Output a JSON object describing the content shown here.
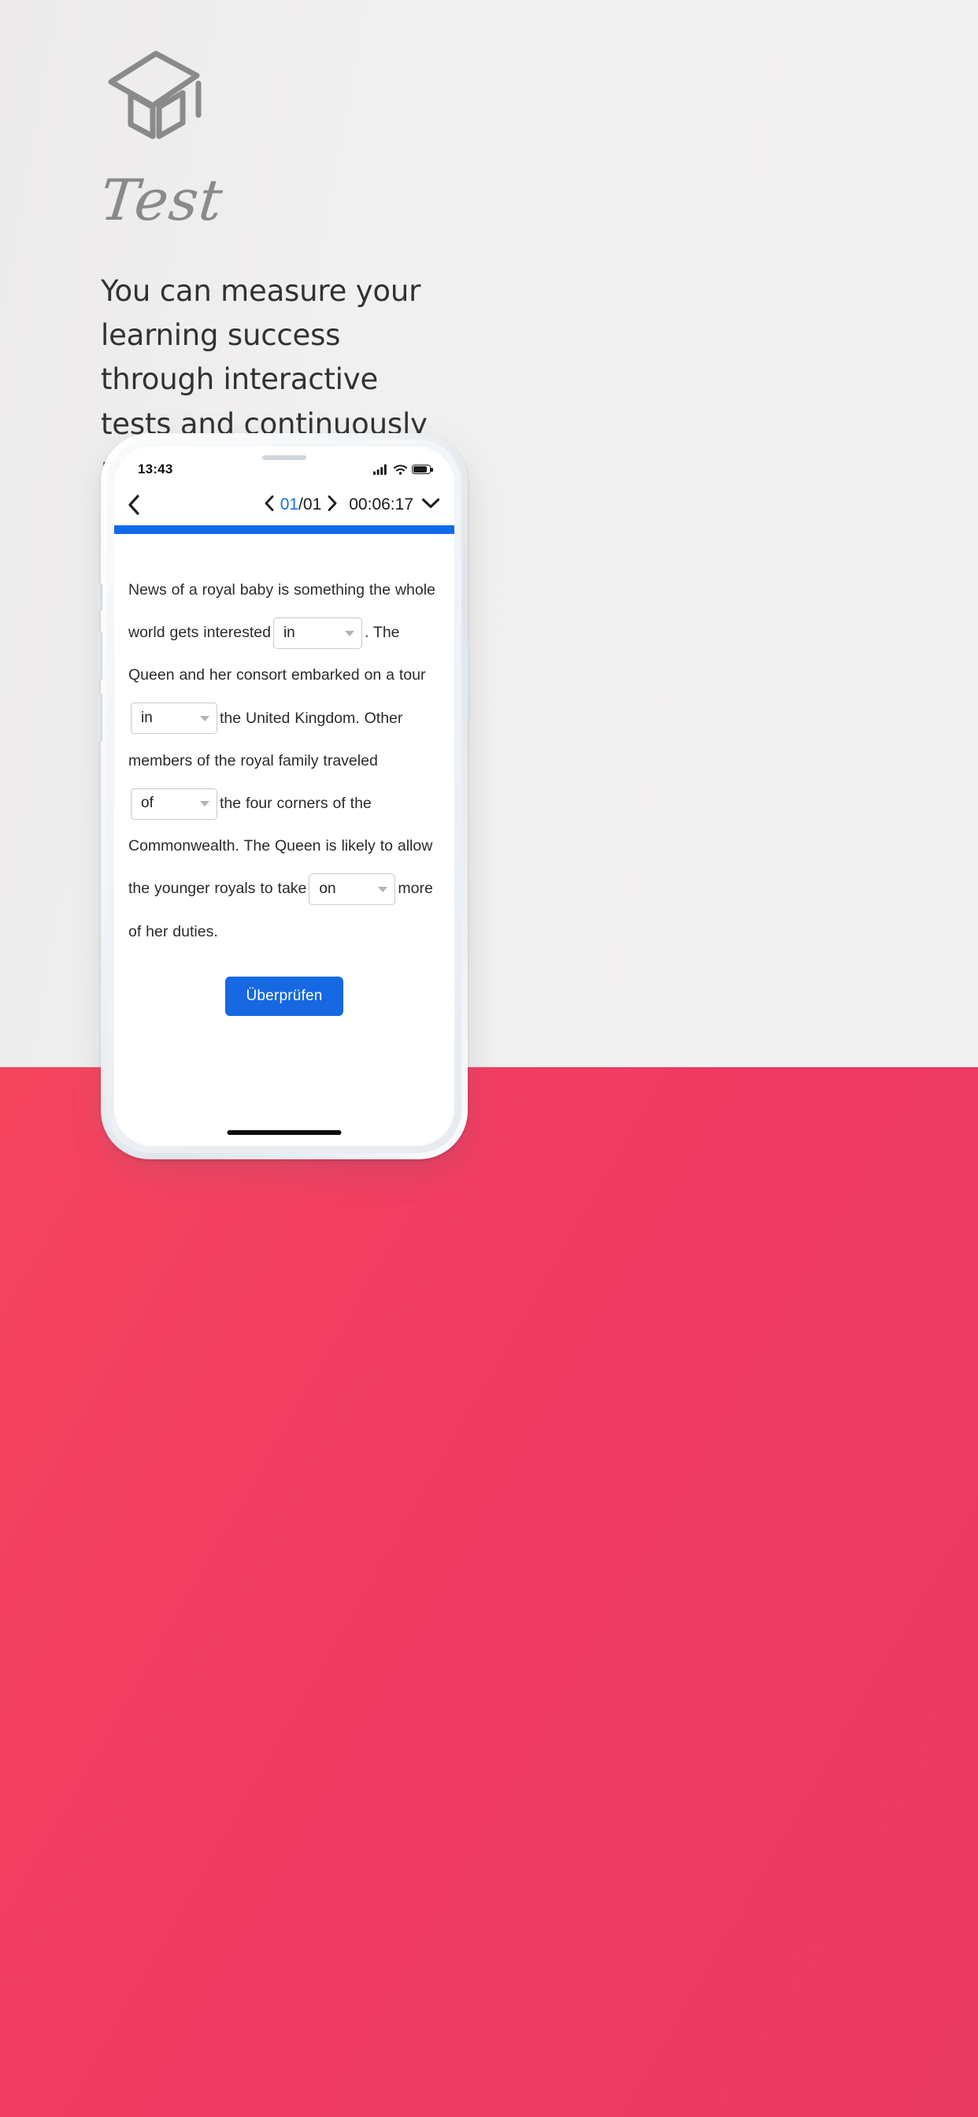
{
  "promo": {
    "icon_name": "graduation-cap-icon",
    "title": "Test",
    "description": "You can measure your learning success through interactive tests and continuously monitor your learning progress."
  },
  "theme": {
    "background": "#f0efef",
    "accent_pink": "#ef3a62",
    "accent_blue": "#1668e3",
    "pager_blue": "#1273e8",
    "icon_gray": "#8a8a8a",
    "text_dark": "#323232"
  },
  "phone": {
    "statusbar": {
      "time": "13:43",
      "signal_icon": "cellular-signal-icon",
      "wifi_icon": "wifi-icon",
      "battery_icon": "battery-icon"
    },
    "navbar": {
      "back_icon": "chevron-left-icon",
      "prev_icon": "chevron-left-icon",
      "next_icon": "chevron-right-icon",
      "current_page": "01",
      "page_separator": "/",
      "total_pages": "01",
      "timer": "00:06:17",
      "collapse_icon": "chevron-down-icon"
    },
    "progress": {
      "percent": 100,
      "color": "#0f6aec"
    },
    "exercise": {
      "segments": [
        {
          "type": "text",
          "value": "News of a royal baby is something the whole world gets interested"
        },
        {
          "type": "select",
          "value": "in",
          "dropdown_icon": "caret-down-icon"
        },
        {
          "type": "text",
          "value": ". The Queen and her consort embarked on a tour"
        },
        {
          "type": "select",
          "value": "in",
          "dropdown_icon": "caret-down-icon"
        },
        {
          "type": "text",
          "value": "the United Kingdom. Other members of the royal family traveled"
        },
        {
          "type": "select",
          "value": "of",
          "dropdown_icon": "caret-down-icon"
        },
        {
          "type": "text",
          "value": "the four corners of the Commonwealth. The Queen is likely to allow the younger royals to take"
        },
        {
          "type": "select",
          "value": "on",
          "dropdown_icon": "caret-down-icon"
        },
        {
          "type": "text",
          "value": "more of her duties."
        }
      ],
      "submit_label": "Überprüfen"
    },
    "home_indicator": "home-indicator"
  }
}
